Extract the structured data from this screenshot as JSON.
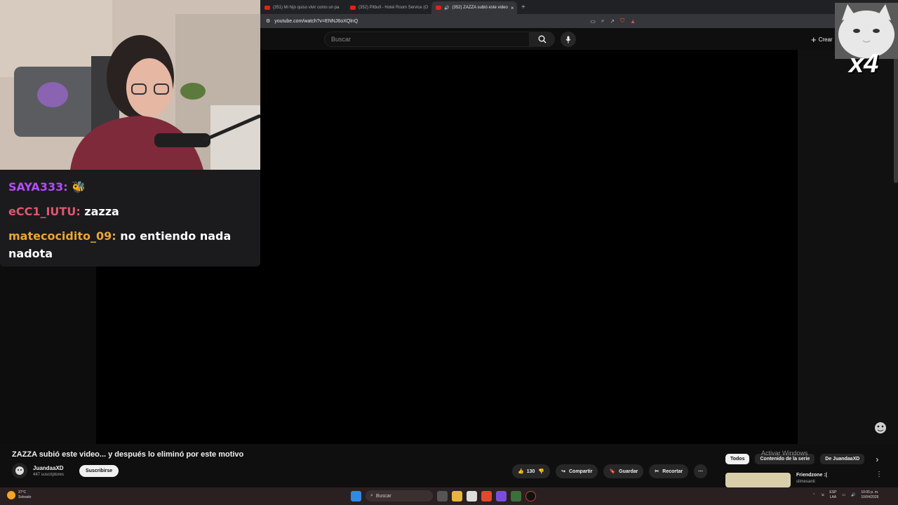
{
  "browser": {
    "tabs": [
      {
        "label": "(351) Mi hijo quiso vivir como un pa"
      },
      {
        "label": "(352) Pitbull - Hotel Room Service (O"
      },
      {
        "label": "(352) ZAZZA subió este video",
        "active": true
      }
    ],
    "new_tab": "+",
    "url": "youtube.com/watch?v=ENNJ6oXQlnQ"
  },
  "youtube": {
    "search_placeholder": "Buscar",
    "create_label": "Crear"
  },
  "chat": {
    "messages": [
      {
        "user": "SAYA333:",
        "text": "",
        "emote": "emote-icon"
      },
      {
        "user": "eCC1_IUTU:",
        "text": "zazza"
      },
      {
        "user": "matecocidito_09:",
        "text": "no entiendo nada nadota"
      }
    ]
  },
  "overlay": {
    "cat_badge": "x4"
  },
  "video": {
    "title": "ZAZZA subió este video... y después lo eliminó por este motivo",
    "channel": "JuandaaXD",
    "subscribers": "447 suscriptores",
    "subscribe_label": "Suscribirse",
    "likes": "130",
    "share_label": "Compartir",
    "save_label": "Guardar",
    "clip_label": "Recortar"
  },
  "sidebar": {
    "chips": [
      "Todos",
      "Contenido de la serie",
      "De JuandaaXD"
    ],
    "watermark": "Activar Windows",
    "recommendation": {
      "title": "Friendzone :(",
      "channel": "slimesanti"
    }
  },
  "taskbar": {
    "weather_temp": "27°C",
    "weather_desc": "Soleado",
    "search": "Buscar",
    "lang_top": "ESP",
    "lang_bottom": "LAA",
    "time": "10:05 p. m.",
    "date": "10/04/2026"
  },
  "colors": {
    "accent_red": "#e62117",
    "chat_bg": "#1b1b1d"
  }
}
